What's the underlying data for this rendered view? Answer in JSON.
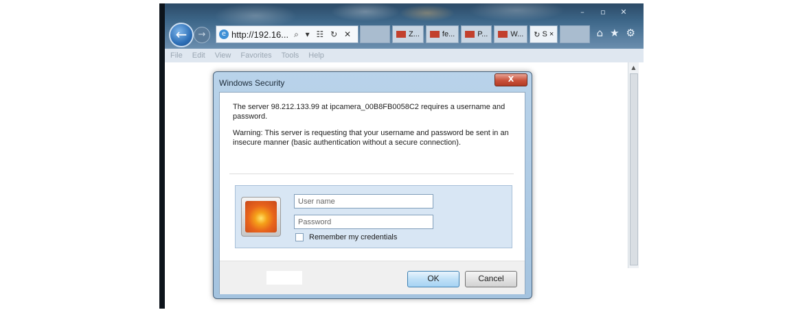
{
  "browser": {
    "address_url": "http://192.16...",
    "address_controls": "⌕ ▾ ☷ ↻ ✕",
    "tabs": [
      {
        "label": "Z...",
        "icon": "red-favicon-icon"
      },
      {
        "label": "fe...",
        "icon": "red-favicon-icon"
      },
      {
        "label": "P...",
        "icon": "red-favicon-icon"
      },
      {
        "label": "W...",
        "icon": "red-favicon-icon"
      },
      {
        "label": "S ×",
        "icon": "loading-icon"
      }
    ],
    "menu": [
      "File",
      "Edit",
      "View",
      "Favorites",
      "Tools",
      "Help"
    ],
    "window_controls": [
      "–",
      "▫",
      "✕"
    ],
    "toolbar_icons": [
      "⌂",
      "★",
      "⚙"
    ]
  },
  "dialog": {
    "title": "Windows Security",
    "close_label": "X",
    "message_1": "The server 98.212.133.99 at ipcamera_00B8FB0058C2 requires a username and password.",
    "message_2": "Warning: This server is requesting that your username and password be sent in an insecure manner (basic authentication without a secure connection).",
    "username_placeholder": "User name",
    "password_placeholder": "Password",
    "remember_label": "Remember my credentials",
    "ok_label": "OK",
    "cancel_label": "Cancel"
  },
  "colors": {
    "dialog_frame": "#a4c3df",
    "close_button": "#c9513a",
    "ok_button": "#bfe0f7"
  }
}
